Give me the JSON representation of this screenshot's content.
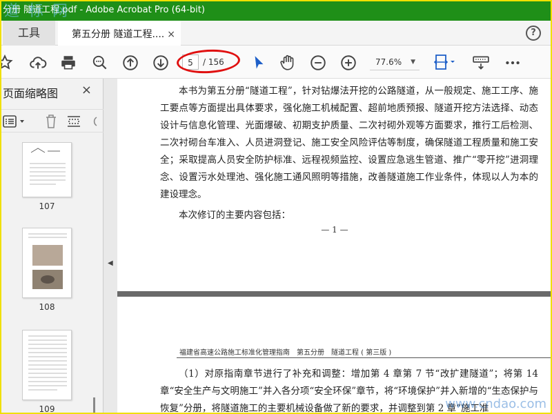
{
  "window": {
    "title": "分册 隧道工程.pdf - Adobe Acrobat Pro (64-bit)",
    "watermark": "道 标 网"
  },
  "tabs": {
    "tools_label": "工具",
    "doc_label": "第五分册 隧道工程....",
    "close_symbol": "×",
    "help_symbol": "?"
  },
  "toolbar": {
    "page_current": "5",
    "page_total": "/ 156",
    "zoom_value": "77.6%",
    "icons": [
      "star-icon",
      "upload-icon",
      "print-icon",
      "search-icon",
      "prev-page-icon",
      "next-page-icon",
      "select-cursor-icon",
      "hand-icon",
      "zoom-out-icon",
      "zoom-in-icon",
      "fit-width-icon",
      "keyboard-icon",
      "more-icon"
    ]
  },
  "sidebar": {
    "title": "页面缩略图",
    "close_symbol": "×",
    "thumbnails": [
      {
        "page": "107"
      },
      {
        "page": "108"
      },
      {
        "page": "109"
      }
    ]
  },
  "document": {
    "page1": {
      "paragraphs": [
        "本书为第五分册“隧道工程”，针对钻爆法开挖的公路隧道，从一般规定、施工工序、施工要点等方面提出具体要求，强化施工机械配置、超前地质预报、隧道开挖方法选择、动态设计与信息化管理、光面爆破、初期支护质量、二次衬砌外观等方面要求，推行工后检测、二次衬砌台车准入、人员进洞登记、施工安全风险评估等制度，确保隧道工程质量和施工安全；采取提高人员安全防护标准、远程视频监控、设置应急逃生管道、推广“零开挖”进洞理念、设置污水处理池、强化施工通风照明等措施，改善隧道施工作业条件，体现以人为本的建设理念。",
        "本次修订的主要内容包括："
      ],
      "page_number": "— 1 —"
    },
    "page2": {
      "running_header": "福建省高速公路施工标准化管理指南　第五分册　隧道工程 ( 第三版 )",
      "paragraph": "（1）对原指南章节进行了补充和调整：增加第 4 章第 7 节“改扩建隧道”；将第 14 章“安全生产与文明施工”并入各分项“安全环保”章节，将“环境保护”并入新增的“生态保护与恢复”分册，将隧道施工的主要机械设备做了新的要求，并调整到第 2 章“施工准"
    },
    "watermark_url": "www.cndao.com"
  }
}
